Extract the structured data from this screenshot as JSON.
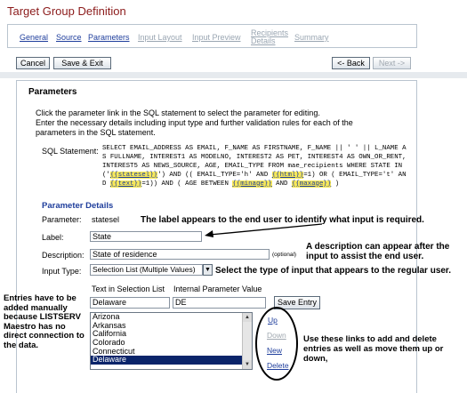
{
  "page_title": "Target Group Definition",
  "wizard_nav": [
    {
      "label": "General",
      "state": "done"
    },
    {
      "label": "Source",
      "state": "done"
    },
    {
      "label": "Parameters",
      "state": "active"
    },
    {
      "label": "Input Layout",
      "state": "disabled"
    },
    {
      "label": "Input Preview",
      "state": "disabled"
    },
    {
      "label": "Recipients",
      "state": "disabled"
    },
    {
      "label": "Details",
      "state": "disabled"
    },
    {
      "label": "Summary",
      "state": "disabled"
    }
  ],
  "toolbar": {
    "cancel": "Cancel",
    "save_exit": "Save & Exit",
    "back": "<- Back",
    "next": "Next ->"
  },
  "section_title": "Parameters",
  "intro_lines": [
    "Click the parameter link in the SQL statement to select the parameter for editing.",
    "Enter the necessary details including input type and further validation rules for each of the",
    "parameters in the SQL statement."
  ],
  "sql": {
    "label": "SQL Statement:",
    "part1": "SELECT EMAIL_ADDRESS AS EMAIL, F_NAME AS FIRSTNAME, F_NAME || ' ' || L_NAME AS FULLNAME, INTEREST1 AS MODELNO, INTEREST2 AS PET, INTEREST4 AS OWN_OR_RENT, INTEREST5 AS NEWS_SOURCE, AGE, EMAIL_TYPE FROM mae_recipients WHERE STATE IN ('",
    "param1": "{{statesel}}",
    "part2": "') AND (( EMAIL_TYPE='h' AND ",
    "param2": "{{html}}",
    "part3": "=1) OR ( EMAIL_TYPE='t' AND ",
    "param3": "{{text}}",
    "part4": "=1)) AND ( AGE BETWEEN ",
    "param4": "{{minage}}",
    "part5": " AND ",
    "param5": "{{maxage}}",
    "part6": " )"
  },
  "parameter_details": {
    "title": "Parameter Details",
    "parameter_label": "Parameter:",
    "parameter_value": "statesel",
    "label_label": "Label:",
    "label_value": "State",
    "description_label": "Description:",
    "description_value": "State of residence",
    "optional_text": "(optional)",
    "input_type_label": "Input Type:",
    "input_type_value": "Selection List (Multiple Values)",
    "col_text": "Text in Selection List",
    "col_internal": "Internal Parameter Value",
    "text_value": "Delaware",
    "internal_value": "DE",
    "save_entry": "Save Entry",
    "list_items": [
      "Arizona",
      "Arkansas",
      "California",
      "Colorado",
      "Connecticut",
      "Delaware"
    ],
    "selected_item": "Delaware",
    "links": {
      "up": "Up",
      "down": "Down",
      "new": "New",
      "delete": "Delete"
    }
  },
  "callouts": {
    "label": "The label appears to the end user to identify what input is required.",
    "description": "A description can appear after the input to assist the end user.",
    "input_type": "Select the type of input that appears to the regular user.",
    "entries": "Entries have to be added manually because LISTSERV Maestro has no direct connection to the data.",
    "links": "Use these links to add and delete entries as well as move them up or down,"
  },
  "colors": {
    "title": "#8b1a1a",
    "link": "#1f3e9c",
    "disabled": "#9aa6b2",
    "highlight": "#f7e85a",
    "selected_bg": "#0a246a"
  }
}
